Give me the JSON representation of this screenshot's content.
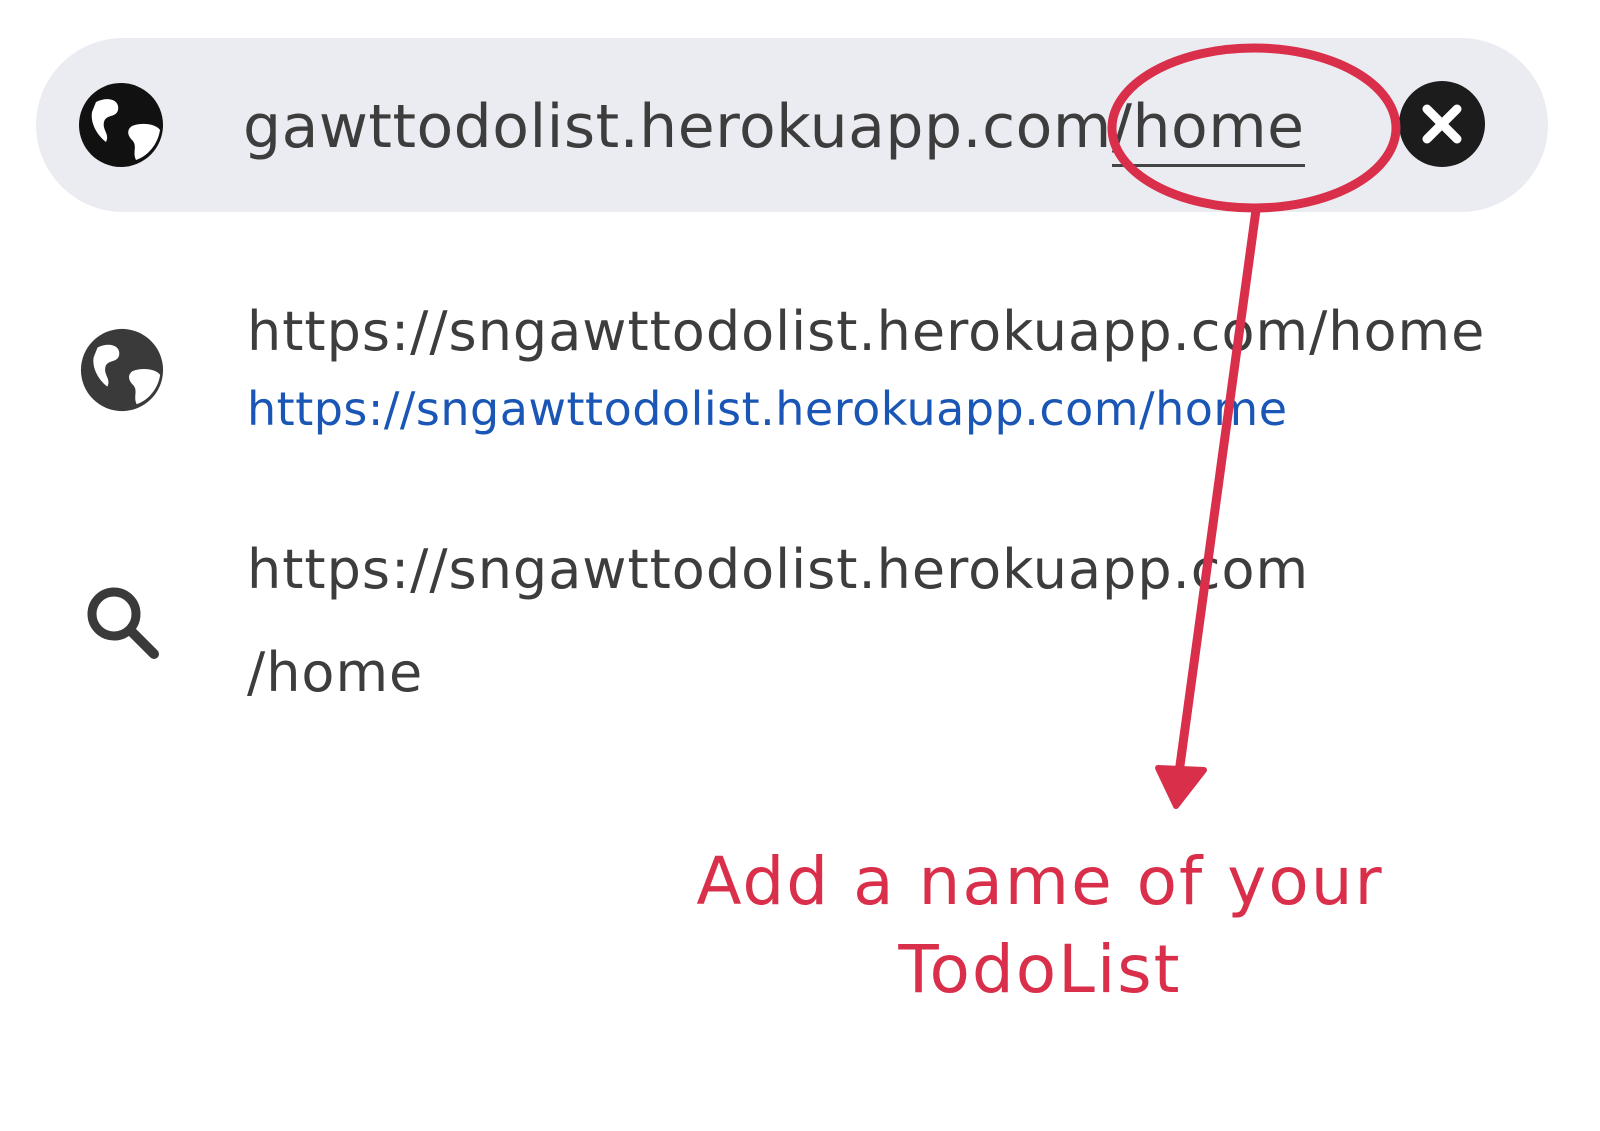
{
  "address_bar": {
    "url_prefix": "gawttodolist.herokuapp.com",
    "url_path": "/home",
    "clear_icon": "close-icon",
    "site_icon": "globe-icon"
  },
  "suggestions": [
    {
      "icon": "globe-icon",
      "title": "https://sngawttodolist.herokuapp.com/home",
      "url": "https://sngawttodolist.herokuapp.com/home"
    },
    {
      "icon": "search-icon",
      "query_line1": "https://sngawttodolist.herokuapp.com",
      "query_line2": "/home"
    }
  ],
  "annotation": {
    "text_line1": "Add a name of your",
    "text_line2": "TodoList",
    "color": "#d92f4a"
  },
  "colors": {
    "bar_background": "#ebecf1",
    "link_blue": "#1a56b5",
    "text": "#3d3d3d"
  }
}
